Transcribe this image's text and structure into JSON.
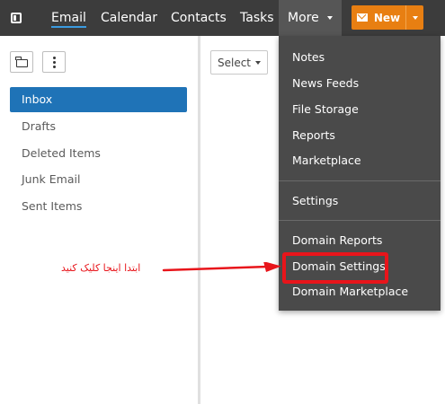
{
  "nav": {
    "tabs": [
      {
        "label": "Email",
        "active": true
      },
      {
        "label": "Calendar"
      },
      {
        "label": "Contacts"
      },
      {
        "label": "Tasks"
      }
    ],
    "more_label": "More",
    "new_label": "New"
  },
  "folders": [
    "Inbox",
    "Drafts",
    "Deleted Items",
    "Junk Email",
    "Sent Items"
  ],
  "select_label": "Select",
  "menu": {
    "group1": [
      "Notes",
      "News Feeds",
      "File Storage",
      "Reports",
      "Marketplace"
    ],
    "group2": [
      "Settings"
    ],
    "group3": [
      "Domain Reports",
      "Domain Settings",
      "Domain Marketplace"
    ]
  },
  "annotation": {
    "text": "ابتدا اینجا کلیک کنید",
    "highlighted_item": "Domain Settings"
  },
  "colors": {
    "topbar": "#3c3c3c",
    "accent_orange": "#e87f12",
    "active_blue": "#1f73b7",
    "menu_bg": "#4a4a4a",
    "annotation_red": "#e8151b"
  }
}
